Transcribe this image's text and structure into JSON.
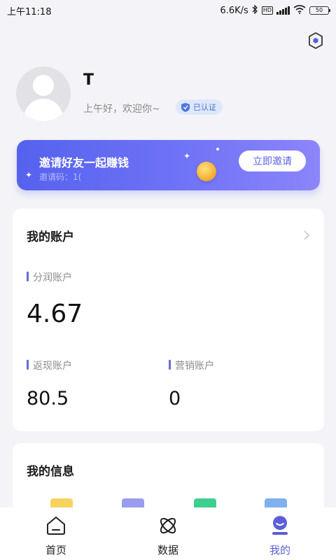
{
  "status_bar": {
    "time": "上午11:18",
    "network_speed": "6.6K/s",
    "battery": "50",
    "volte": "VoLTE"
  },
  "profile": {
    "name": "T",
    "greeting": "上午好，欢迎你~",
    "verified_label": "已认证"
  },
  "invite": {
    "title": "邀请好友一起赚钱",
    "code_label": "邀请码：1(",
    "button_label": "立即邀请"
  },
  "account": {
    "title": "我的账户",
    "profit_label": "分润账户",
    "profit_value": "4.67",
    "cashback_label": "返现账户",
    "cashback_value": "80.5",
    "marketing_label": "营销账户",
    "marketing_value": "0"
  },
  "info": {
    "title": "我的信息"
  },
  "nav": {
    "items": [
      {
        "label": "首页",
        "icon": "home-icon"
      },
      {
        "label": "数据",
        "icon": "atom-icon"
      },
      {
        "label": "我的",
        "icon": "profile-icon"
      }
    ],
    "active_index": 2
  },
  "colors": {
    "accent": "#5a5ed8",
    "banner_start": "#5562ee",
    "banner_end": "#8c85fa",
    "background": "#f4f4f8"
  }
}
